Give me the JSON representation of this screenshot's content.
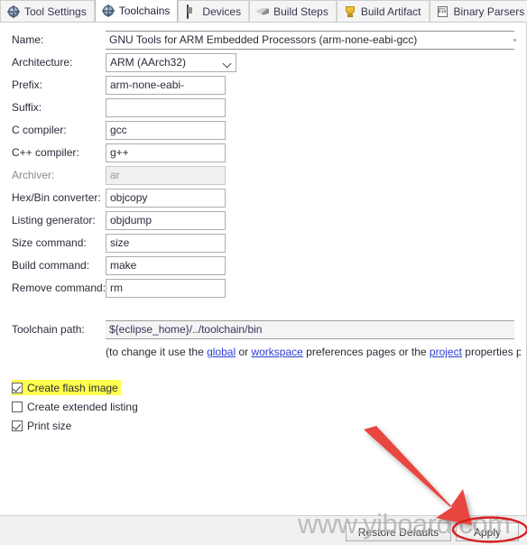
{
  "tabs": [
    {
      "label": "Tool Settings",
      "icon": "gear-globe-icon",
      "selected": false
    },
    {
      "label": "Toolchains",
      "icon": "gear-globe-icon",
      "selected": true
    },
    {
      "label": "Devices",
      "icon": "device-icon",
      "selected": false
    },
    {
      "label": "Build Steps",
      "icon": "wrench-icon",
      "selected": false
    },
    {
      "label": "Build Artifact",
      "icon": "trophy-icon",
      "selected": false
    },
    {
      "label": "Binary Parsers",
      "icon": "binary-doc-icon",
      "selected": false
    }
  ],
  "tab_scroll": {
    "left": "◀",
    "right": "▶"
  },
  "form": {
    "name": {
      "label": "Name:",
      "value": "GNU Tools for ARM Embedded Processors (arm-none-eabi-gcc)"
    },
    "architecture": {
      "label": "Architecture:",
      "value": "ARM (AArch32)"
    },
    "prefix": {
      "label": "Prefix:",
      "value": "arm-none-eabi-"
    },
    "suffix": {
      "label": "Suffix:",
      "value": ""
    },
    "c_compiler": {
      "label": "C compiler:",
      "value": "gcc"
    },
    "cpp_compiler": {
      "label": "C++ compiler:",
      "value": "g++"
    },
    "archiver": {
      "label": "Archiver:",
      "value": "ar"
    },
    "hex_converter": {
      "label": "Hex/Bin converter:",
      "value": "objcopy"
    },
    "listing_generator": {
      "label": "Listing generator:",
      "value": "objdump"
    },
    "size_command": {
      "label": "Size command:",
      "value": "size"
    },
    "build_command": {
      "label": "Build command:",
      "value": "make"
    },
    "remove_command": {
      "label": "Remove command:",
      "value": "rm"
    },
    "toolchain_path": {
      "label": "Toolchain path:",
      "value": "${eclipse_home}/../toolchain/bin"
    }
  },
  "hint": {
    "part1": "(to change it use the ",
    "link_global": "global",
    "part2": " or ",
    "link_workspace": "workspace",
    "part3": " preferences pages or the ",
    "link_project": "project",
    "part4": " properties pag"
  },
  "checkboxes": [
    {
      "label": "Create flash image",
      "checked": true,
      "highlighted": true
    },
    {
      "label": "Create extended listing",
      "checked": false,
      "highlighted": false
    },
    {
      "label": "Print size",
      "checked": true,
      "highlighted": false
    }
  ],
  "buttons": {
    "restore_defaults": "Restore Defaults",
    "apply": "Apply"
  },
  "annotations": {
    "watermark": "www.yiboard.com",
    "arrow_color": "#e8473f",
    "ellipse_color": "#d81e20",
    "highlight_color": "#ffff4d"
  }
}
